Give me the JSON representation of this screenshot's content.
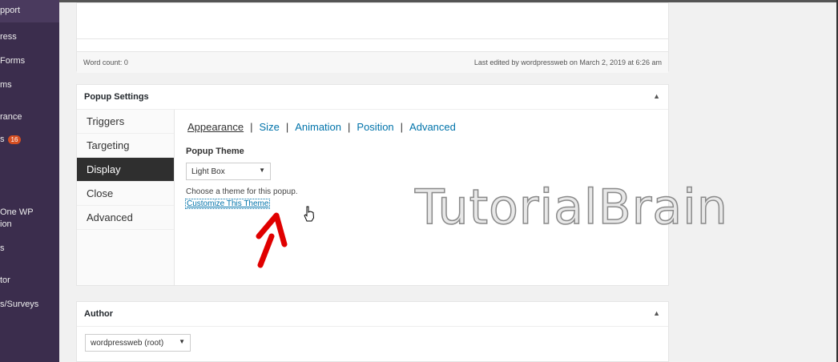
{
  "sidebar": {
    "items": [
      {
        "label": "pport"
      },
      {
        "label": "ress"
      },
      {
        "label": "Forms"
      },
      {
        "label": "ms"
      },
      {
        "label": "rance"
      },
      {
        "label": "s",
        "badge": "16"
      },
      {
        "label": "One WP"
      },
      {
        "label": "ion"
      },
      {
        "label": "s"
      },
      {
        "label": "tor"
      },
      {
        "label": "s/Surveys"
      }
    ]
  },
  "editor": {
    "word_count": "Word count: 0",
    "last_edited": "Last edited by wordpressweb on March 2, 2019 at 6:26 am"
  },
  "popup_settings": {
    "title": "Popup Settings",
    "toggle_icon": "▲",
    "tabs": [
      {
        "label": "Triggers"
      },
      {
        "label": "Targeting"
      },
      {
        "label": "Display"
      },
      {
        "label": "Close"
      },
      {
        "label": "Advanced"
      }
    ],
    "active_tab": "Display",
    "subnav": [
      {
        "label": "Appearance"
      },
      {
        "label": "Size"
      },
      {
        "label": "Animation"
      },
      {
        "label": "Position"
      },
      {
        "label": "Advanced"
      }
    ],
    "subnav_separator": "|",
    "theme_label": "Popup Theme",
    "theme_value": "Light Box",
    "theme_help": "Choose a theme for this popup.",
    "customize_link": "Customize This Theme"
  },
  "author": {
    "title": "Author",
    "toggle_icon": "▲",
    "value": "wordpressweb (root)"
  },
  "watermark": "TutorialBrain",
  "colors": {
    "sidebar_bg": "#3b2d4d",
    "link": "#0073aa",
    "active_tab": "#2f2f2f",
    "badge": "#d54e21",
    "annotation_arrow": "#e00000"
  }
}
